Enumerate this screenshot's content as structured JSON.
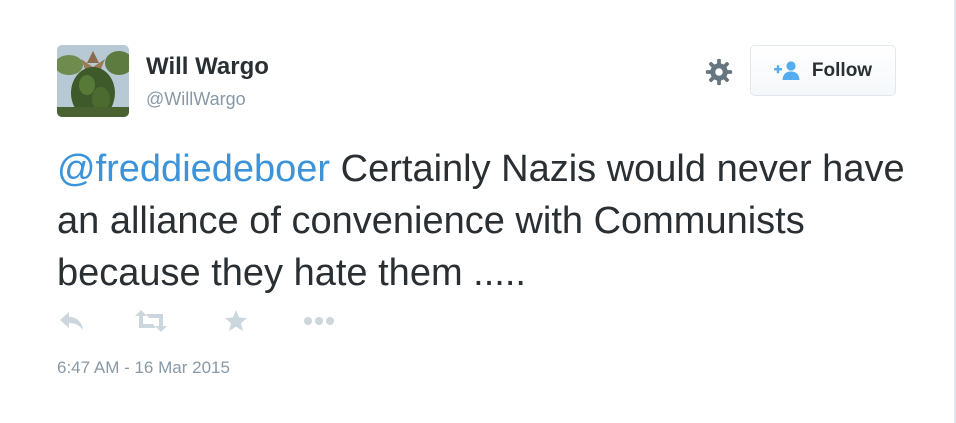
{
  "user": {
    "name": "Will Wargo",
    "handle": "@WillWargo"
  },
  "follow_button": {
    "label": "Follow"
  },
  "tweet": {
    "mention": "@freddiedeboer",
    "text": " Certainly Nazis would never have an alliance of convenience with Communists because they hate them ....."
  },
  "timestamp": "6:47 AM - 16 Mar 2015",
  "icons": {
    "settings": "gear-icon",
    "follow": "follow-user-plus-icon",
    "reply": "reply-icon",
    "retweet": "retweet-icon",
    "favorite": "star-icon",
    "more": "more-dots-icon"
  },
  "colors": {
    "link": "#3b94d9",
    "text": "#292f33",
    "muted": "#8899a6",
    "icon": "#ccd6dd",
    "follow_icon": "#55acee"
  }
}
